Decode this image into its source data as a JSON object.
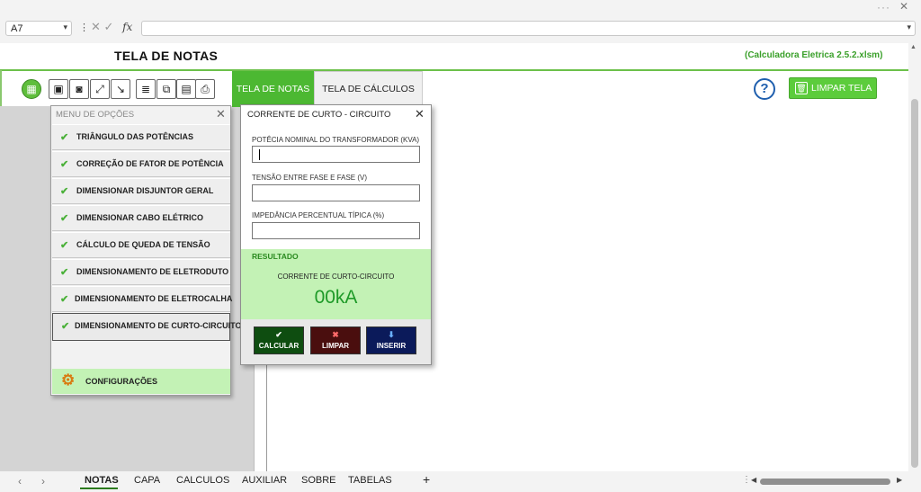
{
  "window": {
    "more_glyph": "···",
    "close_glyph": "✕"
  },
  "formula_bar": {
    "name_box": "A7",
    "cancel_glyph": "✕",
    "confirm_glyph": "✓",
    "fx_label": "fx",
    "formula_value": ""
  },
  "header": {
    "title": "TELA DE NOTAS",
    "file_name": "(Calculadora Eletrica 2.5.2.xlsm)"
  },
  "toolbar": {
    "tabs": {
      "notas": "TELA DE NOTAS",
      "calculos": "TELA DE CÁLCULOS"
    },
    "help_glyph": "?",
    "clear_button": "LIMPAR TELA"
  },
  "menu": {
    "title": "MENU DE OPÇÕES",
    "close_glyph": "✕",
    "items": [
      {
        "label": "TRIÂNGULO DAS POTÊNCIAS"
      },
      {
        "label": "CORREÇÃO DE FATOR DE POTÊNCIA"
      },
      {
        "label": "DIMENSIONAR DISJUNTOR GERAL"
      },
      {
        "label": "DIMENSIONAR CABO ELÉTRICO"
      },
      {
        "label": "CÁLCULO DE QUEDA DE TENSÃO"
      },
      {
        "label": "DIMENSIONAMENTO DE ELETRODUTO"
      },
      {
        "label": "DIMENSIONAMENTO DE ELETROCALHA"
      },
      {
        "label": "DIMENSIONAMENTO DE CURTO-CIRCUITO"
      }
    ],
    "config_label": "CONFIGURAÇÕES"
  },
  "dialog": {
    "title": "CORRENTE DE CURTO - CIRCUITO",
    "close_glyph": "✕",
    "fields": [
      {
        "label": "POTÊCIA NOMINAL DO TRANSFORMADOR (KVA)",
        "value": ""
      },
      {
        "label": "TENSÃO ENTRE FASE E FASE (V)",
        "value": ""
      },
      {
        "label": "IMPEDÂNCIA PERCENTUAL TÍPICA (%)",
        "value": ""
      }
    ],
    "result_heading": "RESULTADO",
    "result_label": "CORRENTE DE CURTO-CIRCUITO",
    "result_value": "00kA",
    "buttons": {
      "calcular": "CALCULAR",
      "limpar": "LIMPAR",
      "inserir": "INSERIR"
    }
  },
  "sheet_tabs": [
    "NOTAS",
    "CAPA",
    "CALCULOS",
    "AUXILIAR",
    "SOBRE",
    "TABELAS"
  ],
  "colors": {
    "accent_green": "#4cb832",
    "calc_btn": "#0e4d10",
    "clear_btn": "#4a0e0e",
    "insert_btn": "#0b1a5a",
    "result_bg": "#c3f2b5"
  }
}
